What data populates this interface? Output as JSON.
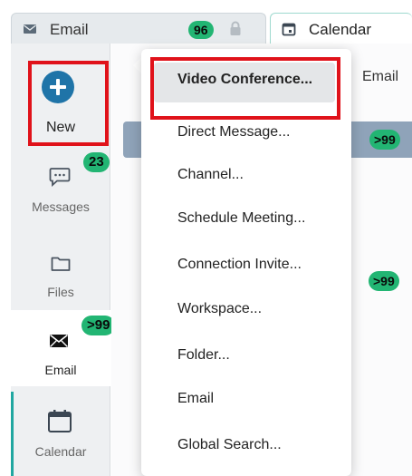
{
  "tabs": {
    "email": {
      "label": "Email",
      "count": "96"
    },
    "calendar": {
      "label": "Calendar"
    }
  },
  "sidebar": {
    "new_label": "New",
    "messages": {
      "label": "Messages",
      "badge": "23"
    },
    "files": {
      "label": "Files"
    },
    "email": {
      "label": "Email",
      "badge": ">99"
    },
    "calendar": {
      "label": "Calendar"
    }
  },
  "list": {
    "column_header": "Email",
    "row_counts": [
      ">99",
      ">99"
    ]
  },
  "menu": {
    "items": [
      "Video Conference...",
      "Direct Message...",
      "Channel...",
      "Schedule Meeting...",
      "Connection Invite...",
      "Workspace...",
      "Folder...",
      "Email",
      "Global Search..."
    ],
    "active_index": 0
  },
  "colors": {
    "accent_teal": "#21a7a1",
    "badge_green": "#22b573",
    "new_button_blue": "#1f74a8",
    "annotation_red": "#e0121a",
    "selected_row": "#8fa3b9"
  },
  "icons": [
    "envelope-icon",
    "lock-icon",
    "calendar-icon",
    "plus-circle-icon",
    "chat-bubble-icon",
    "folder-icon"
  ]
}
